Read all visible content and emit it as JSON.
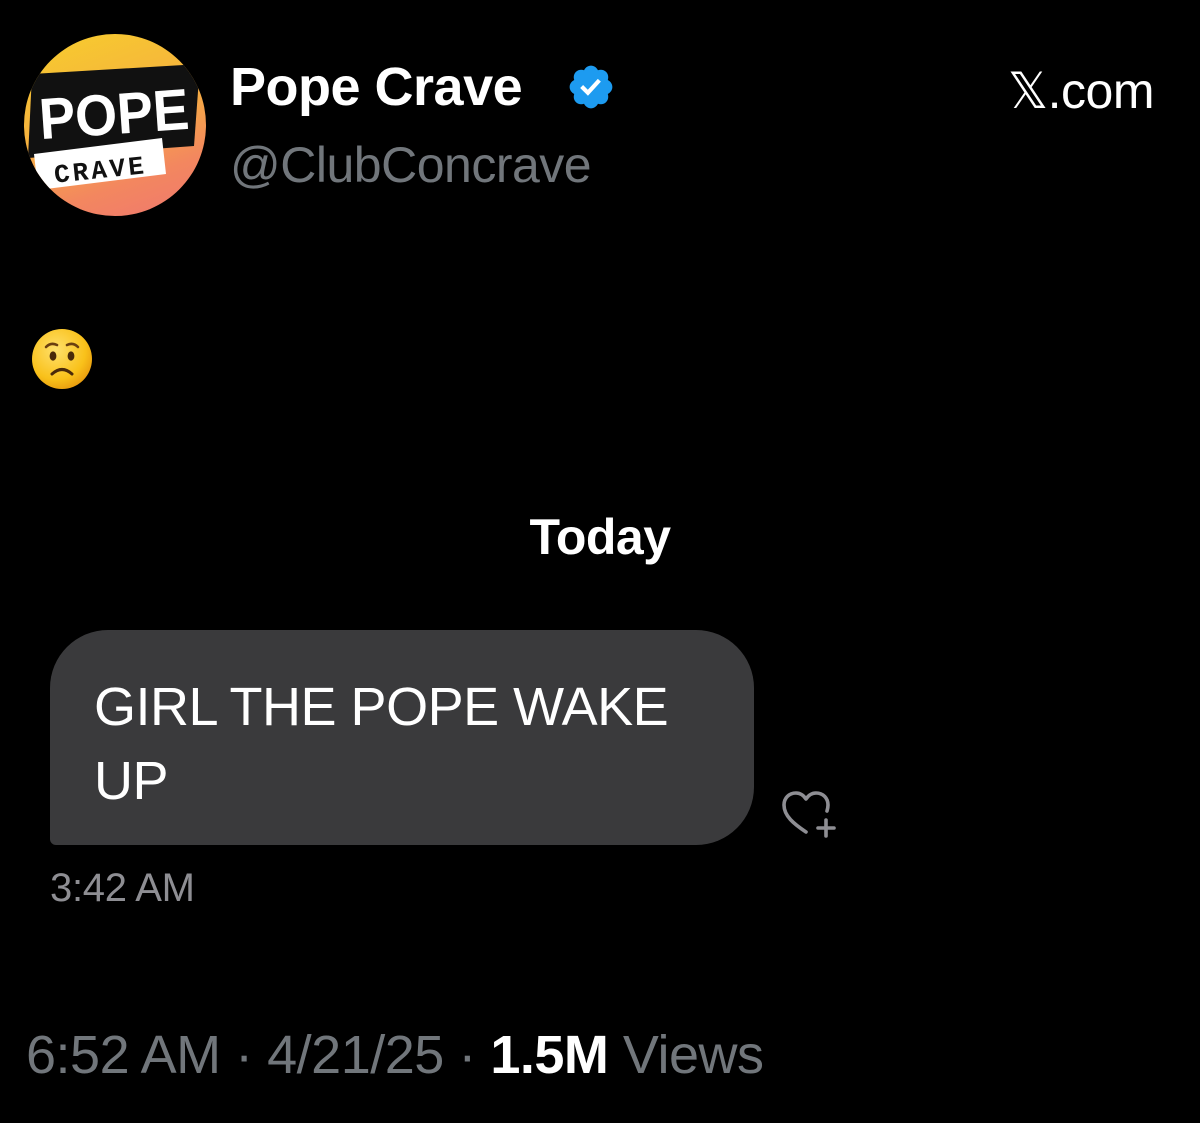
{
  "header": {
    "avatar": {
      "logo_line1": "POPE",
      "logo_line2": "CRAVE",
      "colors": [
        "#f7ce2c",
        "#f3875f"
      ]
    },
    "display_name": "Pope Crave",
    "verified_icon": "verified-badge-icon",
    "verified_color": "#1d9bf0",
    "handle": "@ClubConcrave",
    "watermark": "𝕏.com"
  },
  "post": {
    "emoji": "worried-face-emoji",
    "screenshot": {
      "day_label": "Today",
      "message": "GIRL THE POPE WAKE UP",
      "reaction_icon": "add-reaction-heart-icon",
      "message_time": "3:42 AM",
      "bubble_color": "#3a3a3c"
    }
  },
  "footer": {
    "time": "6:52 AM",
    "separator": "·",
    "date": "4/21/25",
    "views_count": "1.5M",
    "views_label": "Views"
  }
}
